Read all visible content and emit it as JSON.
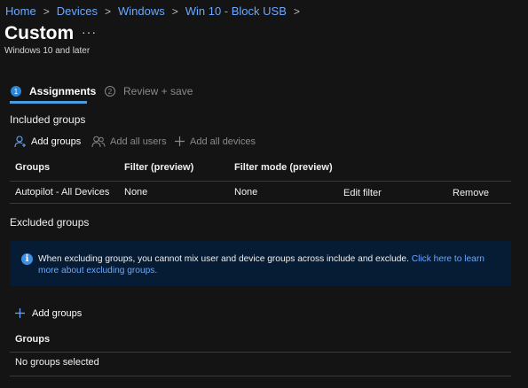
{
  "breadcrumb": [
    "Home",
    "Devices",
    "Windows",
    "Win 10 - Block USB"
  ],
  "page": {
    "title": "Custom",
    "more_label": "···",
    "subtitle": "Windows 10 and later"
  },
  "steps": [
    {
      "number": "1",
      "label": "Assignments",
      "state": "active"
    },
    {
      "number": "2",
      "label": "Review + save",
      "state": "inactive"
    }
  ],
  "included": {
    "title": "Included groups",
    "commands": {
      "add_groups": "Add groups",
      "add_all_users": "Add all users",
      "add_all_devices": "Add all devices"
    },
    "columns": [
      "Groups",
      "Filter (preview)",
      "Filter mode (preview)"
    ],
    "rows": [
      {
        "group": "Autopilot - All Devices",
        "filter": "None",
        "filter_mode": "None",
        "edit_label": "Edit filter",
        "remove_label": "Remove"
      }
    ]
  },
  "excluded": {
    "title": "Excluded groups",
    "info_text": "When excluding groups, you cannot mix user and device groups across include and exclude.",
    "info_link": "Click here to learn more about excluding groups.",
    "add_groups": "Add groups",
    "column": "Groups",
    "empty_text": "No groups selected"
  },
  "colors": {
    "background": "#141414",
    "link": "#6aa8ff",
    "accent": "#2b88d8",
    "banner": "#061b34"
  }
}
